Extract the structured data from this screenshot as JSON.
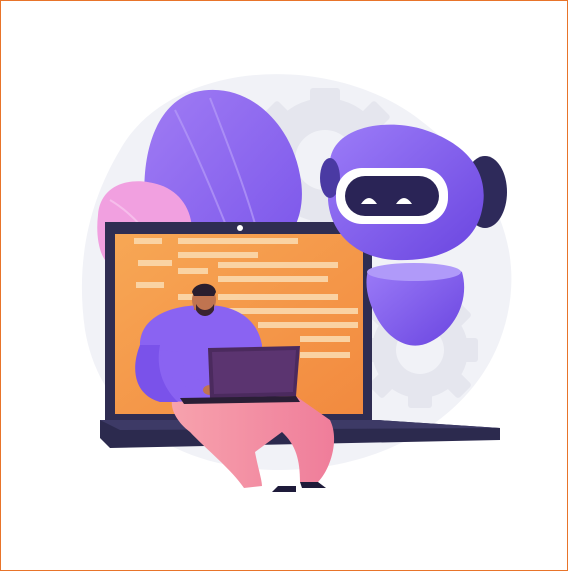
{
  "illustration": {
    "subject": "robot-assistant-with-person-on-laptop",
    "icons": [
      "gear-icon",
      "robot-head-icon",
      "laptop-icon",
      "person-icon",
      "code-screen-icon"
    ]
  },
  "colors": {
    "frame_border": "#e8742a",
    "background_blob": "#f1f2f7",
    "gear": "#e6e7ee",
    "purple": "#8a63f2",
    "purple_dark": "#3b2f77",
    "pink": "#f59aa6",
    "screen_orange": "#f6a24d",
    "laptop_dark": "#2f2d52"
  }
}
